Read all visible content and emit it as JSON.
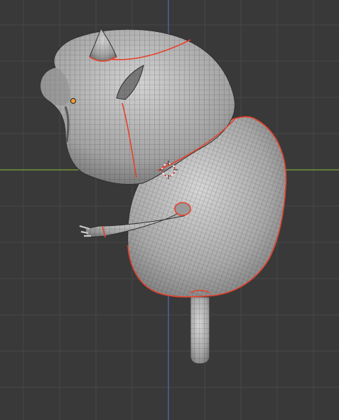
{
  "viewport": {
    "background_color": "#393939",
    "grid_color": "#474747",
    "x_axis_color": "#7da43a",
    "y_axis_color": "#4a70b4",
    "mesh_fill_color": "#a9a9a9",
    "wire_color": "#2a2a2a",
    "seam_color": "#e8412c",
    "origin_color": "#f0a030",
    "cursor_colors": [
      "#ffffff",
      "#e03030"
    ]
  },
  "objects": [
    {
      "name": "character-mesh",
      "icon": "mesh-object"
    },
    {
      "name": "3d-cursor",
      "icon": "3d-cursor-icon"
    },
    {
      "name": "object-origin",
      "icon": "origin-dot"
    }
  ]
}
